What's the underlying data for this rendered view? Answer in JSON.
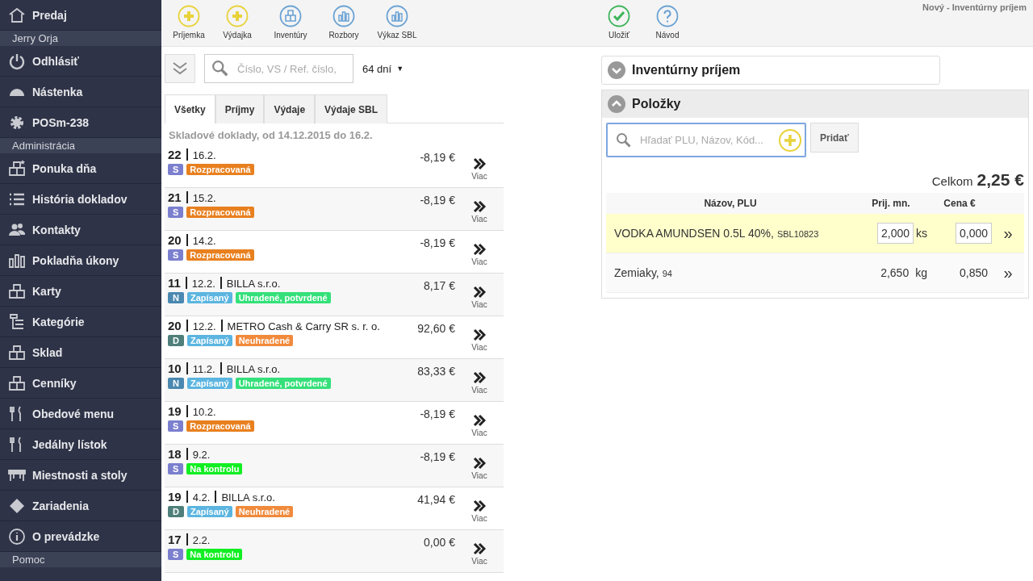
{
  "sidebar": {
    "items": [
      {
        "kind": "item",
        "label": "Predaj"
      },
      {
        "kind": "header",
        "label": "Jerry Orja"
      },
      {
        "kind": "item",
        "label": "Odhlásiť"
      },
      {
        "kind": "item",
        "label": "Nástenka"
      },
      {
        "kind": "item",
        "label": "POSm-238"
      },
      {
        "kind": "header",
        "label": "Administrácia"
      },
      {
        "kind": "item",
        "label": "Ponuka dňa"
      },
      {
        "kind": "item",
        "label": "História dokladov"
      },
      {
        "kind": "item",
        "label": "Kontakty"
      },
      {
        "kind": "item",
        "label": "Pokladňa úkony"
      },
      {
        "kind": "item",
        "label": "Karty"
      },
      {
        "kind": "item",
        "label": "Kategórie"
      },
      {
        "kind": "item",
        "label": "Sklad"
      },
      {
        "kind": "item",
        "label": "Cenníky"
      },
      {
        "kind": "item",
        "label": "Obedové menu"
      },
      {
        "kind": "item",
        "label": "Jedálny lístok"
      },
      {
        "kind": "item",
        "label": "Miestnosti a stoly"
      },
      {
        "kind": "item",
        "label": "Zariadenia"
      },
      {
        "kind": "item",
        "label": "O prevádzke"
      },
      {
        "kind": "header",
        "label": "Pomoc"
      }
    ]
  },
  "toolbar": [
    {
      "label": "Príjemka",
      "kind": "add"
    },
    {
      "label": "Výdajka",
      "kind": "add"
    },
    {
      "label": "Inventúry",
      "kind": "boxes"
    },
    {
      "label": "Rozbory",
      "kind": "bars"
    },
    {
      "label": "Výkaz SBL",
      "kind": "bars"
    }
  ],
  "right_toolbar": [
    {
      "label": "Uložiť",
      "kind": "check"
    },
    {
      "label": "Návod",
      "kind": "help"
    }
  ],
  "page_title": "Nový - Inventúrny príjem",
  "filter": {
    "placeholder": "Číslo, VS / Ref. číslo,",
    "period": "64 dní",
    "period_caret": "▼"
  },
  "tabs": [
    {
      "label": "Všetky",
      "selected": true
    },
    {
      "label": "Príjmy",
      "selected": false
    },
    {
      "label": "Výdaje",
      "selected": false
    },
    {
      "label": "Výdaje SBL",
      "selected": false
    }
  ],
  "list_heading": "Skladové doklady, od 14.12.2015 do 16.2.",
  "documents": [
    {
      "number": "22",
      "date": "16.2.",
      "amount": "-8,19 €",
      "type": {
        "label": "S",
        "color": "#7b7fce"
      },
      "tags": [
        {
          "label": "Rozpracovaná",
          "color": "#e8801f"
        }
      ],
      "more": "Viac"
    },
    {
      "number": "21",
      "date": "15.2.",
      "amount": "-8,19 €",
      "type": {
        "label": "S",
        "color": "#7b7fce"
      },
      "tags": [
        {
          "label": "Rozpracovaná",
          "color": "#e8801f"
        }
      ],
      "more": "Viac"
    },
    {
      "number": "20",
      "date": "14.2.",
      "amount": "-8,19 €",
      "type": {
        "label": "S",
        "color": "#7b7fce"
      },
      "tags": [
        {
          "label": "Rozpracovaná",
          "color": "#e8801f"
        }
      ],
      "more": "Viac"
    },
    {
      "number": "11",
      "date": "12.2.",
      "partner": "BILLA s.r.o.",
      "amount": "8,17 €",
      "type": {
        "label": "N",
        "color": "#4a88b0"
      },
      "tags": [
        {
          "label": "Zapísaný",
          "color": "#5bb5e0"
        },
        {
          "label": "Uhradené, potvrdené",
          "color": "#35e07a"
        }
      ],
      "more": "Viac"
    },
    {
      "number": "20",
      "date": "12.2.",
      "partner": "METRO Cash & Carry SR s. r. o.",
      "amount": "92,60 €",
      "type": {
        "label": "D",
        "color": "#4f7f7a"
      },
      "tags": [
        {
          "label": "Zapísaný",
          "color": "#5bb5e0"
        },
        {
          "label": "Neuhradené",
          "color": "#f08a3c"
        }
      ],
      "more": "Viac"
    },
    {
      "number": "10",
      "date": "11.2.",
      "partner": "BILLA s.r.o.",
      "amount": "83,33 €",
      "type": {
        "label": "N",
        "color": "#4a88b0"
      },
      "tags": [
        {
          "label": "Zapísaný",
          "color": "#5bb5e0"
        },
        {
          "label": "Uhradené, potvrdené",
          "color": "#35e07a"
        }
      ],
      "more": "Viac"
    },
    {
      "number": "19",
      "date": "10.2.",
      "amount": "-8,19 €",
      "type": {
        "label": "S",
        "color": "#7b7fce"
      },
      "tags": [
        {
          "label": "Rozpracovaná",
          "color": "#e8801f"
        }
      ],
      "more": "Viac"
    },
    {
      "number": "18",
      "date": "9.2.",
      "amount": "-8,19 €",
      "type": {
        "label": "S",
        "color": "#7b7fce"
      },
      "tags": [
        {
          "label": "Na kontrolu",
          "color": "#11ee22"
        }
      ],
      "more": "Viac"
    },
    {
      "number": "19",
      "date": "4.2.",
      "partner": "BILLA s.r.o.",
      "amount": "41,94 €",
      "type": {
        "label": "D",
        "color": "#4f7f7a"
      },
      "tags": [
        {
          "label": "Zapísaný",
          "color": "#5bb5e0"
        },
        {
          "label": "Neuhradené",
          "color": "#f08a3c"
        }
      ],
      "more": "Viac"
    },
    {
      "number": "17",
      "date": "2.2.",
      "amount": "0,00 €",
      "type": {
        "label": "S",
        "color": "#7b7fce"
      },
      "tags": [
        {
          "label": "Na kontrolu",
          "color": "#11ee22"
        }
      ],
      "more": "Viac"
    }
  ],
  "sections": [
    {
      "title": "Inventúrny príjem",
      "expanded": false
    },
    {
      "title": "Položky",
      "expanded": true
    }
  ],
  "item_search": {
    "placeholder": "Hľadať PLU, Názov, Kód...",
    "add_button": "Pridať"
  },
  "total": {
    "label": "Celkom",
    "value": "2,25 €"
  },
  "items_table": {
    "columns": [
      "Názov, PLU",
      "Prij. mn.",
      "Cena €"
    ],
    "rows": [
      {
        "name": "VODKA AMUNDSEN 0.5L 40%,",
        "plu": "SBL10823",
        "quantity": "2,000",
        "unit": "ks",
        "price": "0,000",
        "editing": true,
        "more": "»"
      },
      {
        "name": "Zemiaky,",
        "plu": "94",
        "quantity": "2,650",
        "unit": "kg",
        "price": "0,850",
        "editing": false,
        "more": "»"
      }
    ]
  }
}
